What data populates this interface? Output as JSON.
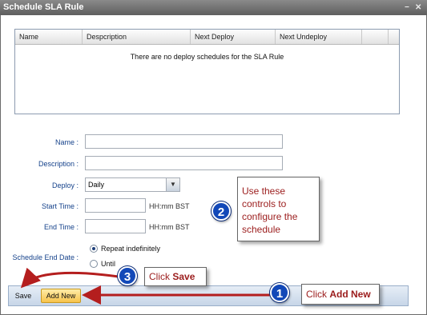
{
  "window": {
    "title": "Schedule SLA Rule",
    "controls": [
      "−",
      "✕"
    ]
  },
  "grid": {
    "columns": [
      "Name",
      "Despcription",
      "Next Deploy",
      "Next Undeploy",
      ""
    ],
    "empty_text": "There are no deploy schedules for the SLA Rule"
  },
  "form": {
    "name_label": "Name :",
    "name_value": "",
    "description_label": "Description :",
    "description_value": "",
    "deploy_label": "Deploy :",
    "deploy_value": "Daily",
    "start_label": "Start Time :",
    "start_value": "",
    "start_unit": "HH:mm BST",
    "end_label": "End Time :",
    "end_value": "",
    "end_unit": "HH:mm BST",
    "end_date_label": "Schedule End Date :",
    "repeat_label": "Repeat indefinitely",
    "until_label": "Until"
  },
  "toolbar": {
    "save_label": "Save",
    "add_label": "Add New"
  },
  "callouts": {
    "one": {
      "number": "1",
      "prefix": "Click ",
      "bold": "Add New"
    },
    "two": {
      "number": "2",
      "text": "Use these controls to configure the schedule"
    },
    "three": {
      "number": "3",
      "prefix": "Click ",
      "bold": "Save"
    }
  },
  "colors": {
    "accent": "#1248b8",
    "callout_text": "#9b1c1c",
    "arrow": "#b41e1e"
  }
}
